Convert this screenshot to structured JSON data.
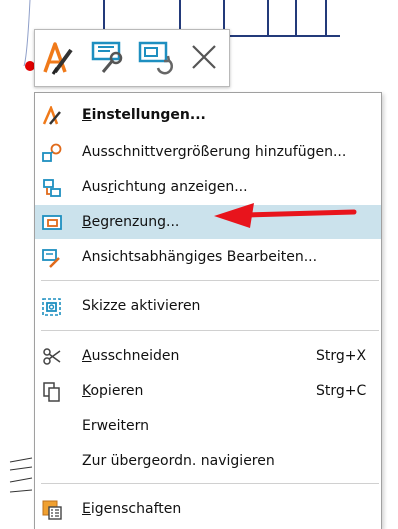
{
  "toolbar": {
    "buttons": [
      {
        "icon": "edit-settings-icon"
      },
      {
        "icon": "wrench-view-icon"
      },
      {
        "icon": "view-refresh-icon"
      },
      {
        "icon": "close-icon"
      }
    ]
  },
  "menu": {
    "items": [
      {
        "pre": "",
        "u": "E",
        "post": "instellungen...",
        "icon": "pencil-brush-icon"
      },
      {
        "pre": "",
        "u": "",
        "post": "Ausschnittvergrößerung hinzufügen...",
        "icon": "detail-view-icon"
      },
      {
        "pre": "Aus",
        "u": "r",
        "post": "ichtung anzeigen...",
        "icon": "orientation-icon"
      },
      {
        "pre": "",
        "u": "B",
        "post": "egrenzung...",
        "icon": "boundary-icon"
      },
      {
        "pre": "",
        "u": "",
        "post": "Ansichtsabhängiges Bearbeiten...",
        "icon": "view-dependent-edit-icon"
      },
      {
        "pre": "",
        "u": "",
        "post": "Skizze aktivieren",
        "icon": "sketch-icon"
      },
      {
        "pre": "",
        "u": "A",
        "post": "usschneiden",
        "icon": "scissors-icon",
        "shortcut": "Strg+X"
      },
      {
        "pre": "",
        "u": "K",
        "post": "opieren",
        "icon": "copy-icon",
        "shortcut": "Strg+C"
      },
      {
        "pre": "",
        "u": "",
        "post": "Erweitern"
      },
      {
        "pre": "",
        "u": "",
        "post": "Zur übergeordn. navigieren"
      },
      {
        "pre": "",
        "u": "E",
        "post": "igenschaften",
        "icon": "properties-icon"
      }
    ]
  },
  "colors": {
    "highlight": "#cbe2ec",
    "arrow": "#e8141c",
    "background_lines": "#233a7a"
  }
}
